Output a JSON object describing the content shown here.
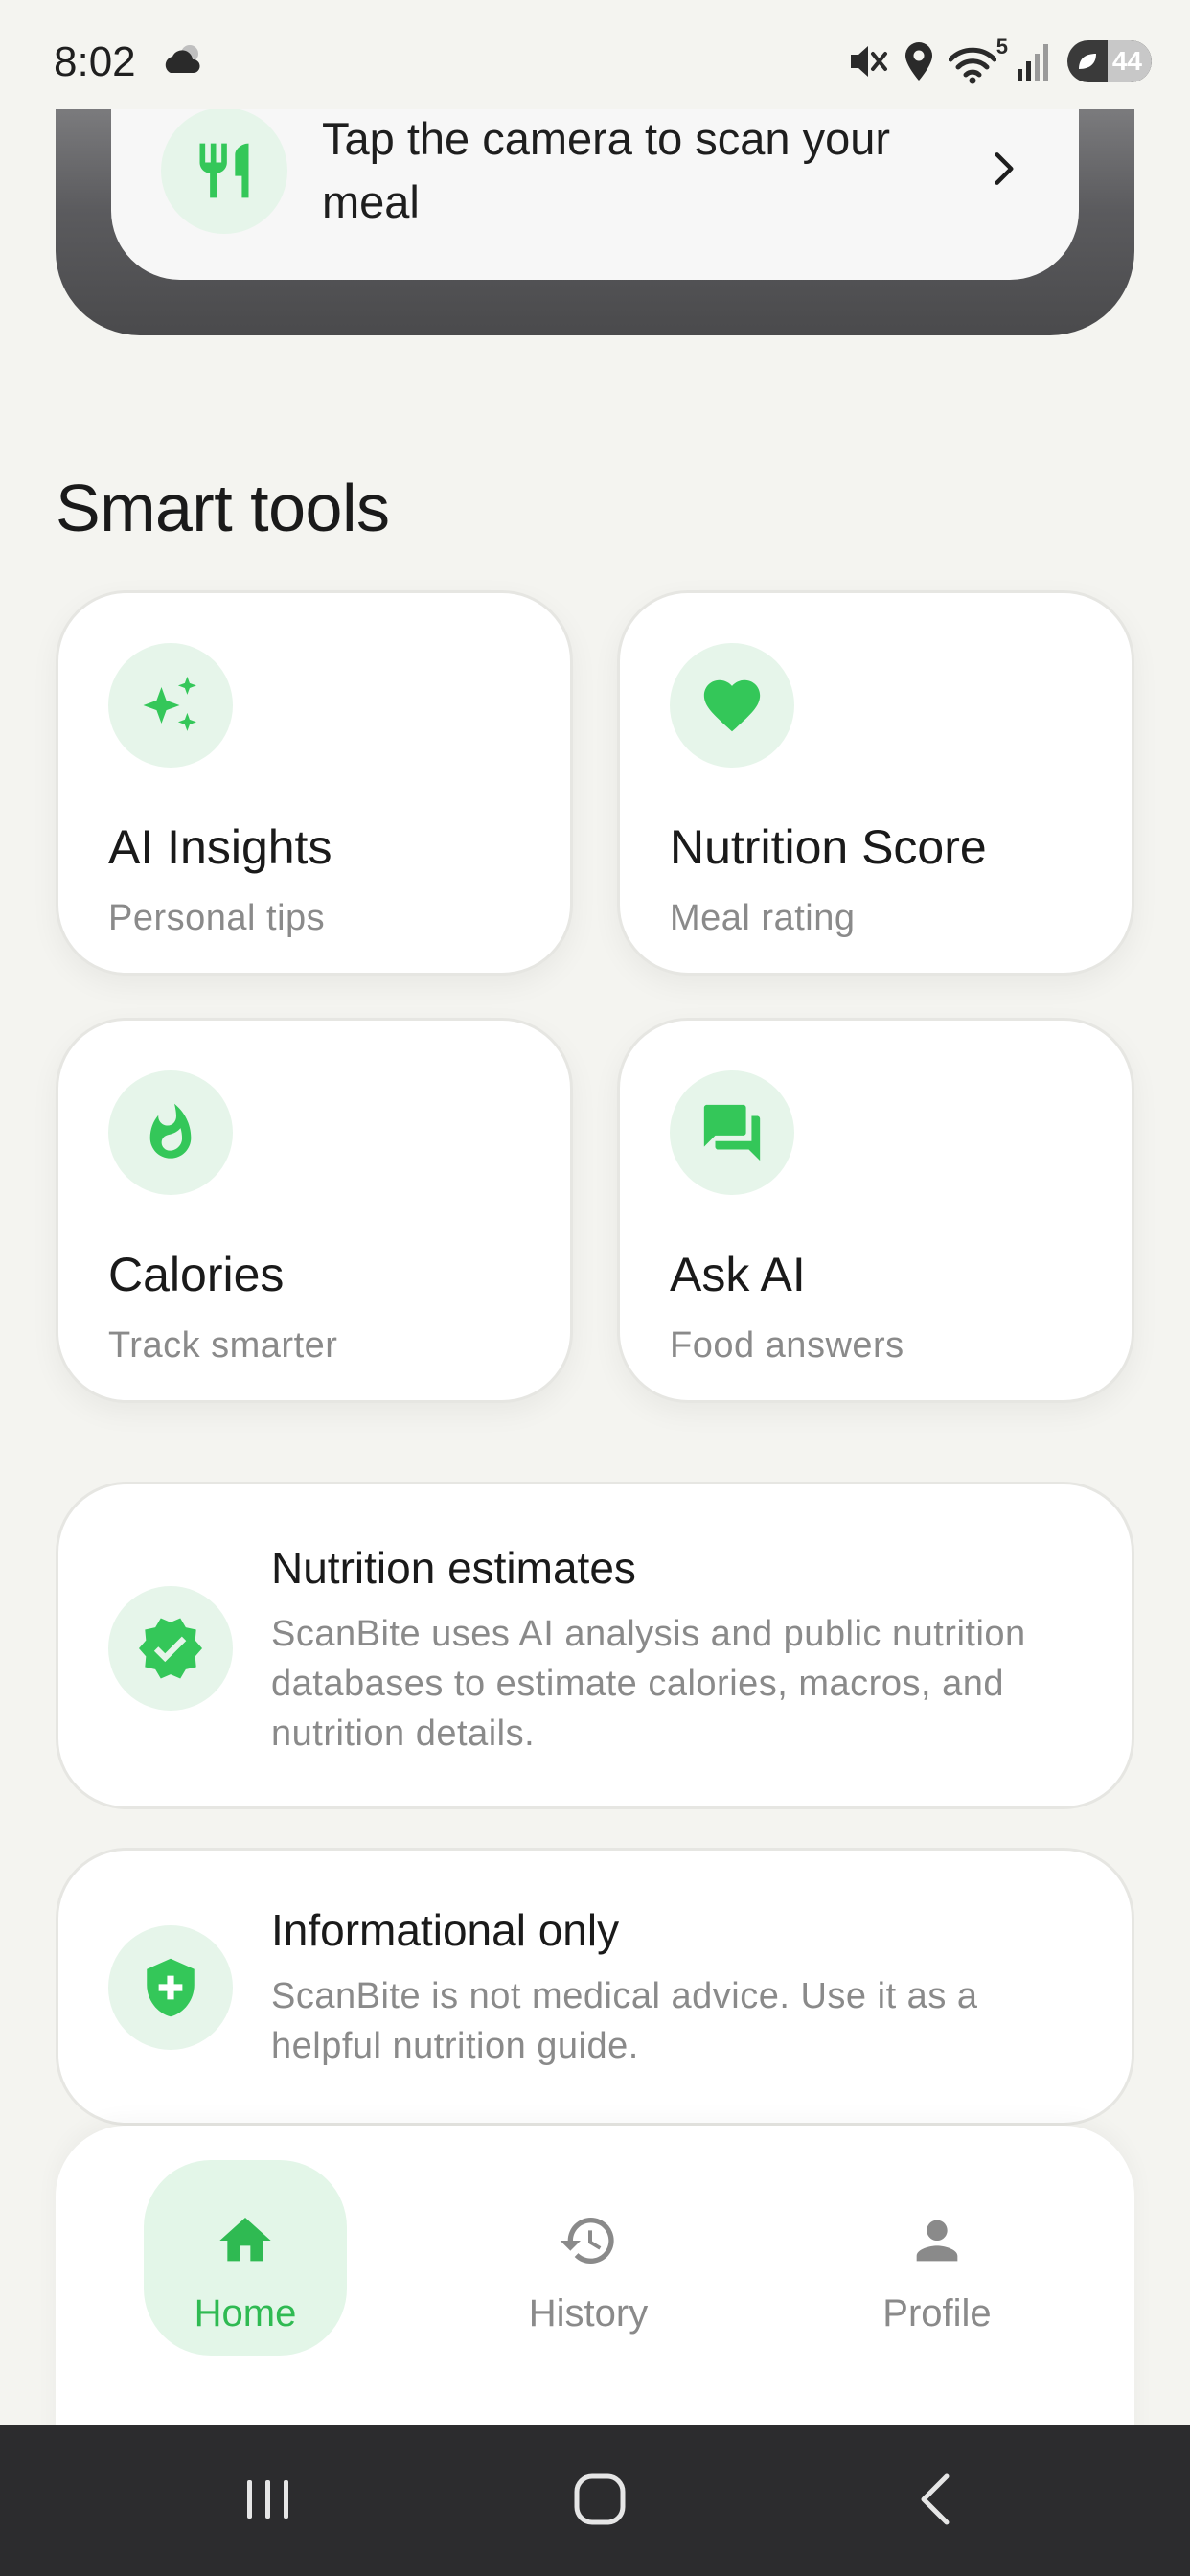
{
  "status_bar": {
    "time": "8:02",
    "wifi_badge": "5",
    "battery": "44"
  },
  "scan_card": {
    "text": "Tap the camera to scan your meal",
    "icon": "fork-knife-icon"
  },
  "smart_tools": {
    "title": "Smart tools",
    "items": [
      {
        "title": "AI Insights",
        "subtitle": "Personal tips",
        "icon": "sparkles-icon"
      },
      {
        "title": "Nutrition Score",
        "subtitle": "Meal rating",
        "icon": "heart-icon"
      },
      {
        "title": "Calories",
        "subtitle": "Track smarter",
        "icon": "flame-icon"
      },
      {
        "title": "Ask AI",
        "subtitle": "Food answers",
        "icon": "chat-bubbles-icon"
      }
    ]
  },
  "info_cards": [
    {
      "title": "Nutrition estimates",
      "body": "ScanBite uses AI analysis and public nutrition databases to estimate calories, macros, and nutrition details.",
      "icon": "verified-badge-icon"
    },
    {
      "title": "Informational only",
      "body": "ScanBite is not medical advice. Use it as a helpful nutrition guide.",
      "icon": "shield-plus-icon"
    }
  ],
  "bottom_nav": {
    "items": [
      {
        "label": "Home",
        "icon": "home-icon",
        "active": true
      },
      {
        "label": "History",
        "icon": "history-icon",
        "active": false
      },
      {
        "label": "Profile",
        "icon": "person-icon",
        "active": false
      }
    ]
  },
  "colors": {
    "accent": "#34c759",
    "accent_dark": "#2fba52",
    "icon_bg": "#e6f5ea",
    "background": "#f4f4f0",
    "muted_text": "#8a8a8a"
  }
}
